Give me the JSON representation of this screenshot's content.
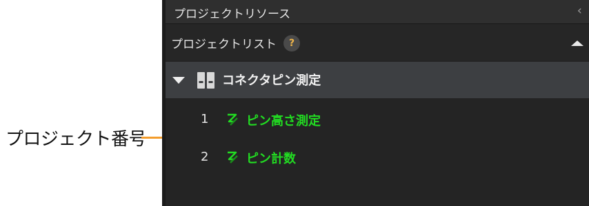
{
  "annotation": {
    "label": "プロジェクト番号",
    "color": "#f39c2b"
  },
  "panel": {
    "title": "プロジェクトリソース",
    "collapse_icon": "chevron-left-icon",
    "list_header": {
      "label": "プロジェクトリスト",
      "help_text": "?",
      "collapse_icon": "triangle-up-icon"
    },
    "project": {
      "expand_icon": "triangle-down-icon",
      "icon": "book-icon",
      "name": "コネクタピン測定"
    },
    "steps": [
      {
        "number": "1",
        "icon": "step-icon",
        "name": "ピン高さ測定"
      },
      {
        "number": "2",
        "icon": "step-icon",
        "name": "ピン計数"
      }
    ],
    "colors": {
      "background": "#242424",
      "selected_row": "#3d3f42",
      "step_text": "#22dc22",
      "help_icon": "#f0b64a"
    }
  }
}
